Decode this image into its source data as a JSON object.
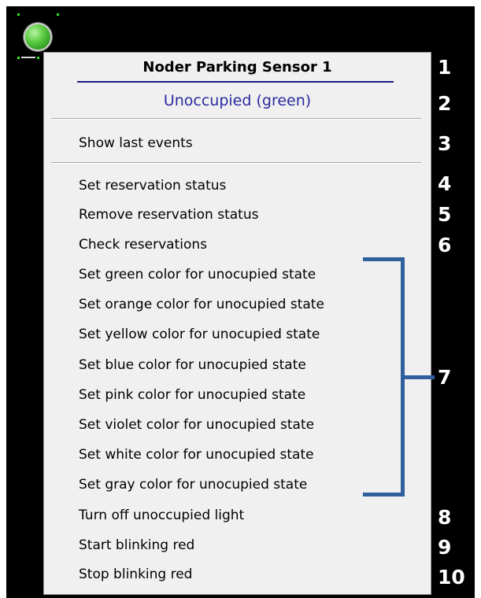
{
  "sensor": {
    "icon": "green-status-light-icon",
    "color": "#4cc235"
  },
  "context_menu": {
    "title": "Noder Parking Sensor 1",
    "status": "Unoccupied (green)",
    "status_color": "#2b2aa0",
    "items": [
      "Show last events",
      "Set reservation status",
      "Remove reservation status",
      "Check reservations",
      "Set green color for unocupied state",
      "Set orange color for unocupied state",
      "Set yellow color for unocupied state",
      "Set blue color for unocupied state",
      "Set pink color for unocupied state",
      "Set violet color for unocupied state",
      "Set white color for unocupied state",
      "Set gray color for unocupied state",
      "Turn off unoccupied light",
      "Start blinking red",
      "Stop blinking red"
    ]
  },
  "annotations": {
    "numbers": [
      "1",
      "2",
      "3",
      "4",
      "5",
      "6",
      "7",
      "8",
      "9",
      "10"
    ],
    "bracket_color": "#2f5f9c"
  }
}
